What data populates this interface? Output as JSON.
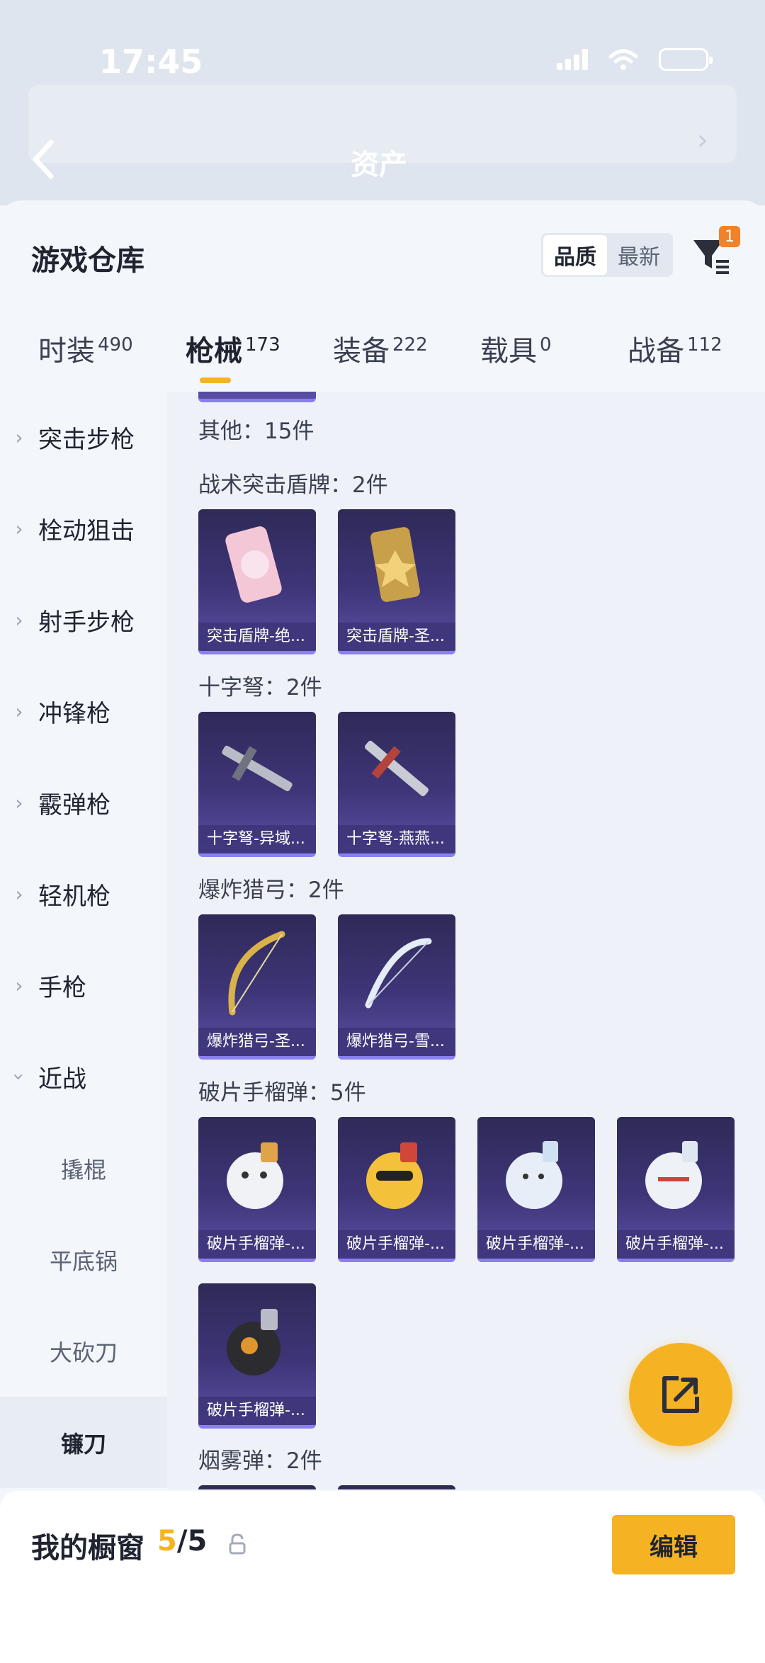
{
  "status_bar": {
    "time": "17:45"
  },
  "background": {
    "title": "资产"
  },
  "sheet": {
    "title": "游戏仓库",
    "sort_options": [
      "品质",
      "最新"
    ],
    "active_sort": "品质",
    "filter_badge": "1"
  },
  "tabs": [
    {
      "label": "时装",
      "count": "490"
    },
    {
      "label": "枪械",
      "count": "173"
    },
    {
      "label": "装备",
      "count": "222"
    },
    {
      "label": "载具",
      "count": "0"
    },
    {
      "label": "战备",
      "count": "112"
    }
  ],
  "sidebar": {
    "items": [
      {
        "label": "突击步枪",
        "expanded": false
      },
      {
        "label": "栓动狙击",
        "expanded": false
      },
      {
        "label": "射手步枪",
        "expanded": false
      },
      {
        "label": "冲锋枪",
        "expanded": false
      },
      {
        "label": "霰弹枪",
        "expanded": false
      },
      {
        "label": "轻机枪",
        "expanded": false
      },
      {
        "label": "手枪",
        "expanded": false
      },
      {
        "label": "近战",
        "expanded": true
      }
    ],
    "sub_items": [
      "撬棍",
      "平底锅",
      "大砍刀",
      "镰刀"
    ],
    "active_sub": "镰刀"
  },
  "content": {
    "sections": [
      {
        "title": "其他：15件",
        "cards": []
      },
      {
        "title": "战术突击盾牌：2件",
        "cards": [
          "突击盾牌-绝...",
          "突击盾牌-圣..."
        ]
      },
      {
        "title": "十字弩：2件",
        "cards": [
          "十字弩-异域...",
          "十字弩-燕燕..."
        ]
      },
      {
        "title": "爆炸猎弓：2件",
        "cards": [
          "爆炸猎弓-圣...",
          "爆炸猎弓-雪..."
        ]
      },
      {
        "title": "破片手榴弹：5件",
        "cards": [
          "破片手榴弹-...",
          "破片手榴弹-...",
          "破片手榴弹-...",
          "破片手榴弹-...",
          "破片手榴弹-..."
        ]
      },
      {
        "title": "烟雾弹：2件",
        "cards": []
      }
    ]
  },
  "footer": {
    "title": "我的橱窗",
    "current": "5",
    "total": "5",
    "edit_label": "编辑"
  },
  "colors": {
    "accent": "#f5b324",
    "badge": "#f0822a",
    "card_border": "#8a7ff0"
  }
}
